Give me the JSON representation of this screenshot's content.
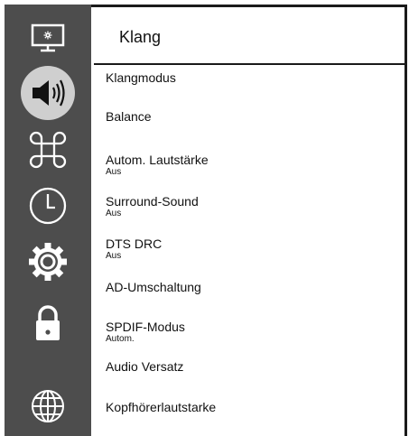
{
  "sidebar": {
    "items": [
      {
        "icon": "picture-settings-icon"
      },
      {
        "icon": "speaker-icon",
        "active": true
      },
      {
        "icon": "command-key-icon"
      },
      {
        "icon": "clock-icon"
      },
      {
        "icon": "gear-icon"
      },
      {
        "icon": "lock-icon"
      },
      {
        "icon": "globe-icon"
      }
    ]
  },
  "header": {
    "title": "Klang"
  },
  "menu": {
    "items": [
      {
        "label": "Klangmodus"
      },
      {
        "label": "Balance"
      },
      {
        "label": "Autom. Lautstärke",
        "value": "Aus"
      },
      {
        "label": "Surround-Sound",
        "value": "Aus"
      },
      {
        "label": "DTS DRC",
        "value": "Aus"
      },
      {
        "label": "AD-Umschaltung"
      },
      {
        "label": "SPDIF-Modus",
        "value": "Autom."
      },
      {
        "label": "Audio Versatz"
      },
      {
        "label": "Kopfhörerlautstarke"
      }
    ]
  },
  "colors": {
    "sidebar": "#4d4d4d",
    "active_circle": "#cfcfcf",
    "icon": "#ffffff",
    "border": "#1a1a1a"
  }
}
